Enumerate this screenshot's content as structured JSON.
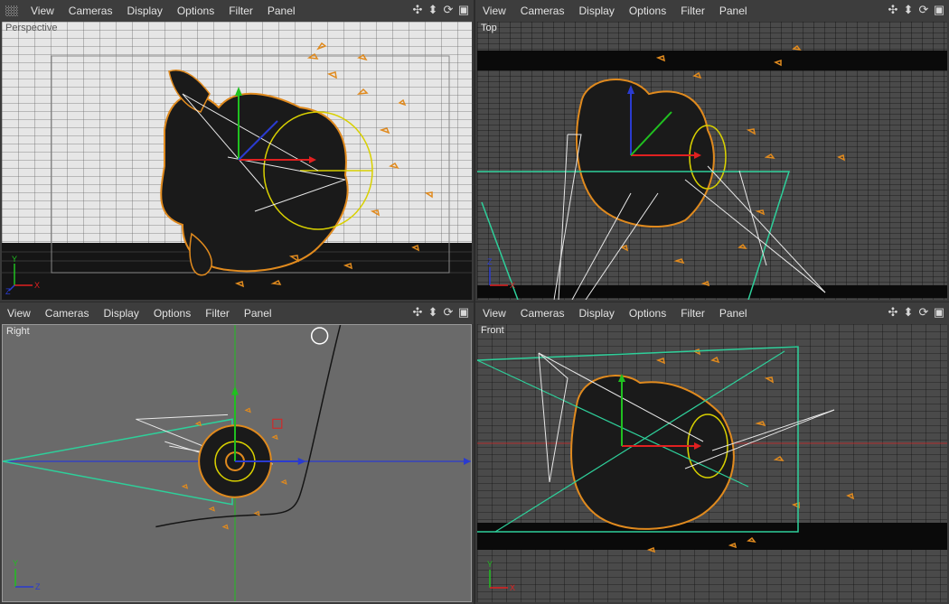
{
  "menu": [
    "View",
    "Cameras",
    "Display",
    "Options",
    "Filter",
    "Panel"
  ],
  "panes": [
    {
      "id": "perspective",
      "label": "Perspective"
    },
    {
      "id": "top",
      "label": "Top"
    },
    {
      "id": "right",
      "label": "Right"
    },
    {
      "id": "front",
      "label": "Front"
    }
  ],
  "nav_icons": [
    "move-view-icon",
    "pan-view-icon",
    "rotate-view-icon",
    "maximize-view-icon"
  ],
  "axis_labels": {
    "perspective": [
      "Y",
      "X",
      "Z"
    ],
    "top": [
      "Z",
      "X"
    ],
    "right": [
      "Y",
      "Z"
    ],
    "front": [
      "Y",
      "X"
    ]
  },
  "colors": {
    "object_outline": "#e08a1e",
    "object_fill": "#1a1a1a",
    "x_axis": "#e02020",
    "y_axis": "#20c020",
    "z_axis": "#2a3bd0",
    "camera_frame": "#2ecf9a",
    "light": "#d8d000"
  }
}
